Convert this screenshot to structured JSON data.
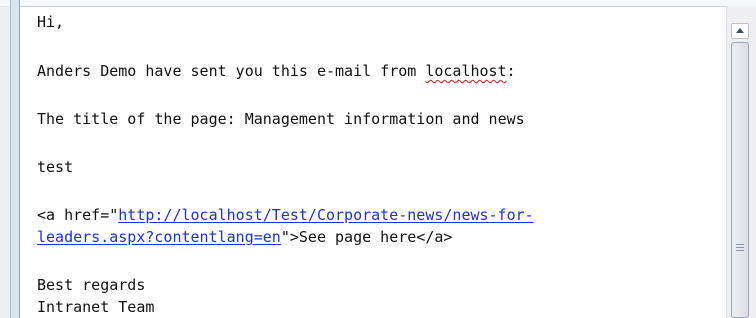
{
  "message": {
    "greeting": "Hi,",
    "sent_prefix": "Anders Demo have sent you this e-mail from ",
    "sent_host": "localhost",
    "sent_suffix": ":",
    "title_line": "The title of the page: Management information and news",
    "body_text": "test",
    "link_open": "<a href=\"",
    "link_url_part1": "http://localhost/Test/Corporate-news/news-for-",
    "link_url_part2": "leaders.aspx?contentlang=en",
    "link_close": "\">See page here</a>",
    "signoff": "Best regards",
    "signature": "Intranet Team"
  },
  "scrollbar": {
    "up_icon": "chevron-up-icon",
    "grip_icon": "grip-lines-icon"
  }
}
